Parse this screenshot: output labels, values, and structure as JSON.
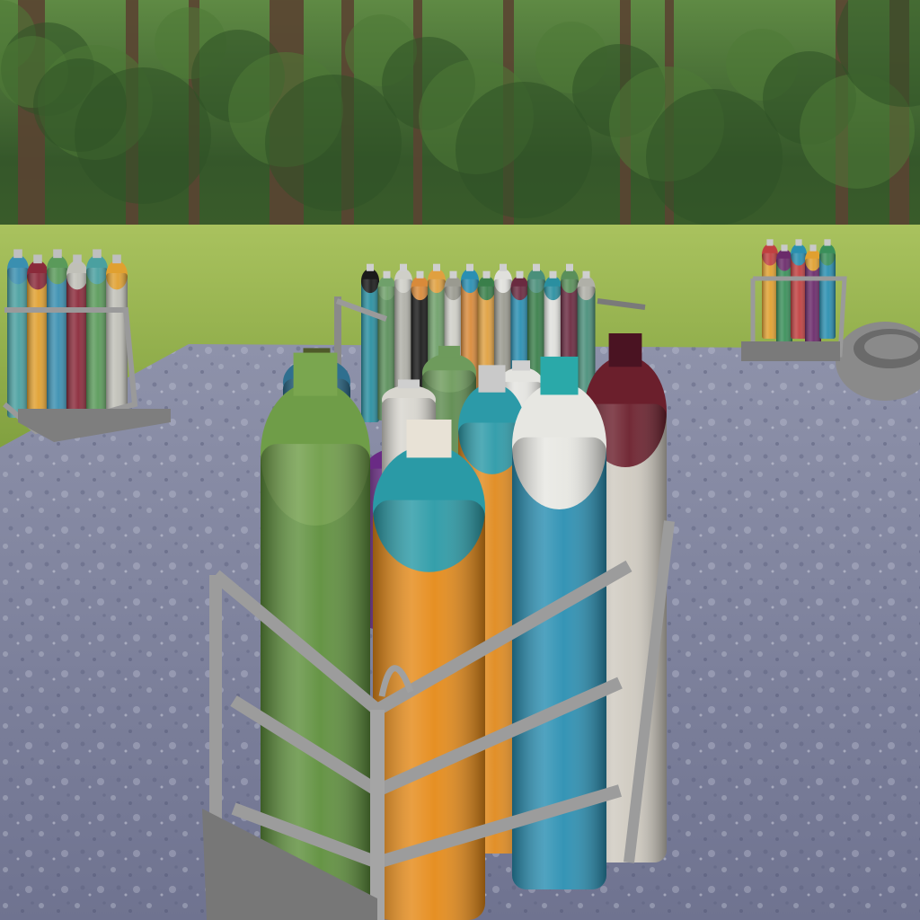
{
  "scene": {
    "kind": "3d-render",
    "setting": "forest clearing",
    "palette": {
      "sky_foliage": "#4f7a36",
      "foliage_dark": "#23401c",
      "grass": "#8fae4a",
      "grass_light": "#b9c96b",
      "trunk": "#5a4432",
      "slab": "#7b7f99",
      "slab_light": "#9ea2b8",
      "rack_metal": "#9a9a9a",
      "rack_dark": "#6e6e6e",
      "ring": "#8a8a8a"
    }
  },
  "cylinders_front": [
    {
      "body": "#5e8f3c",
      "shoulder": "#6f9d48",
      "valve": "#7aa64f"
    },
    {
      "body": "#e58a18",
      "shoulder": "#2a9aa6",
      "valve": "#e8e2d6"
    },
    {
      "body": "#e08a1e",
      "shoulder": "#2c9aa8",
      "valve": "#c9c9c9"
    },
    {
      "body": "#2a8fb2",
      "shoulder": "#e7e7e2",
      "valve": "#2aa9a9"
    },
    {
      "body": "#cfcac0",
      "shoulder": "#6b1f2c",
      "valve": "#4a1322"
    },
    {
      "body": "#6a2a85",
      "shoulder": "#6a2a85",
      "valve": "#cfcfcf"
    },
    {
      "body": "#2f6f8f",
      "shoulder": "#2f6f8f",
      "valve": "#4f5a2a"
    },
    {
      "body": "#5e8b4f",
      "shoulder": "#6e9b5c",
      "valve": "#6e9b5c"
    }
  ],
  "cylinders_back": [
    "#2a8fa0",
    "#5a8f5a",
    "#b0b0a8",
    "#1a1a1a",
    "#6fa06a",
    "#cfcfc8",
    "#d98a3a",
    "#e0a040",
    "#9a9a90",
    "#2a8fb2",
    "#3a7f4a",
    "#e0e0dc",
    "#6a2a40",
    "#4a8f7a"
  ],
  "cylinders_left": [
    "#4aa0a0",
    "#e0a030",
    "#3a8fb0",
    "#8a2a3a",
    "#5a9a5a",
    "#c0c0b8"
  ],
  "cylinders_right": [
    "#e0a030",
    "#3a8f5a",
    "#c04040",
    "#6a2a6a",
    "#2a8fb0"
  ]
}
